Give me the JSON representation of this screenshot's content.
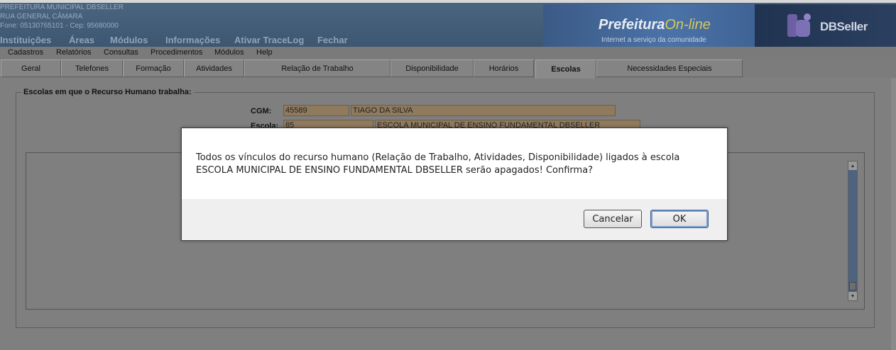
{
  "header": {
    "org_name": "PREFEITURA MUNICIPAL DBSELLER",
    "address": "RUA GENERAL CÂMARA",
    "contact": "Fone: 05130765101  -  Cep: 95680000",
    "main_menu": [
      "Instituições",
      "Áreas",
      "Módulos",
      "Informações",
      "Ativar TraceLog",
      "Fechar"
    ],
    "brand_prefeitura": "Prefeitura",
    "brand_online": "On-line",
    "brand_tagline": "Internet a serviço da comunidade",
    "dbseller": "DBSeller"
  },
  "menubar": {
    "items": [
      "Cadastros",
      "Relatórios",
      "Consultas",
      "Procedimentos",
      "Módulos",
      "Help"
    ]
  },
  "tabs": {
    "items": [
      "Geral",
      "Telefones",
      "Formação",
      "Atividades",
      "Relação de Trabalho",
      "Disponibilidade",
      "Horários",
      "Escolas",
      "Necessidades Especiais"
    ],
    "active": "Escolas"
  },
  "form": {
    "legend": "Escolas em que o Recurso Humano trabalha:",
    "cgm_label": "CGM:",
    "cgm_code": "45589",
    "cgm_name": "TIAGO DA SILVA",
    "escola_label": "Escola:",
    "escola_code": "85",
    "escola_name": "ESCOLA MUNICIPAL DE ENSINO FUNDAMENTAL DBSELLER"
  },
  "dialog": {
    "line1": "Todos os vínculos do recurso humano (Relação de Trabalho, Atividades, Disponibilidade) ligados à escola",
    "line2": "ESCOLA MUNICIPAL DE ENSINO FUNDAMENTAL DBSELLER serão apagados! Confirma?",
    "cancel_label": "Cancelar",
    "ok_label": "OK"
  }
}
